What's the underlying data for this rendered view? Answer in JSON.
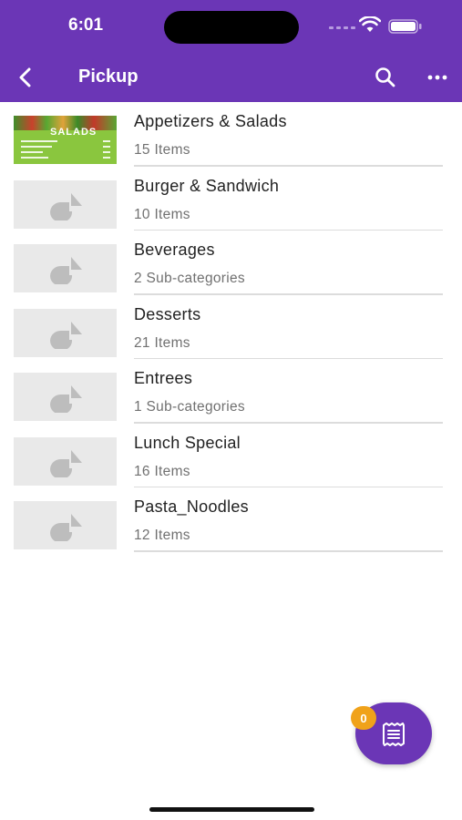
{
  "status_bar": {
    "time": "6:01"
  },
  "nav": {
    "title": "Pickup",
    "back_icon": "chevron-left-icon",
    "search_icon": "search-icon",
    "more_icon": "ellipsis-icon"
  },
  "categories": [
    {
      "name": "Appetizers & Salads",
      "count": "15 Items",
      "thumbnail": "salads-photo",
      "thumb_text": "SALADS"
    },
    {
      "name": "Burger & Sandwich",
      "count": "10 Items",
      "thumbnail": "image-placeholder-icon"
    },
    {
      "name": "Beverages",
      "count": "2 Sub-categories",
      "thumbnail": "image-placeholder-icon"
    },
    {
      "name": "Desserts",
      "count": "21 Items",
      "thumbnail": "image-placeholder-icon"
    },
    {
      "name": "Entrees",
      "count": "1 Sub-categories",
      "thumbnail": "image-placeholder-icon"
    },
    {
      "name": "Lunch Special",
      "count": "16 Items",
      "thumbnail": "image-placeholder-icon"
    },
    {
      "name": "Pasta_Noodles",
      "count": "12 Items",
      "thumbnail": "image-placeholder-icon"
    }
  ],
  "cart": {
    "badge_count": "0",
    "icon": "receipt-icon"
  },
  "colors": {
    "brand": "#6b36b6",
    "badge": "#f0a21a",
    "divider": "#dcdcdc"
  }
}
